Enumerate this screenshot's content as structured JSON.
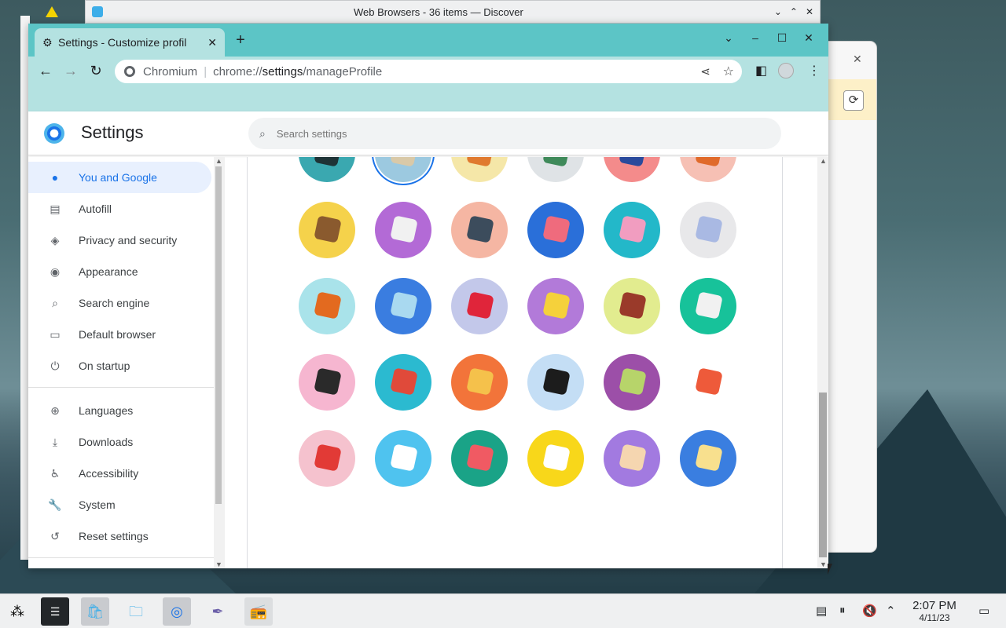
{
  "desktop": {
    "discover_title": "Web Browsers - 36 items — Discover",
    "discover_controls": [
      "⌄",
      "⌃",
      "✕"
    ]
  },
  "browser": {
    "tab_title": "Settings - Customize profil",
    "tab_close": "✕",
    "new_tab": "+",
    "window_controls": [
      "⌄",
      "–",
      "☐",
      "✕"
    ],
    "omnibox": {
      "host": "Chromium",
      "url_prefix": "chrome://",
      "url_bold": "settings",
      "url_suffix": "/manageProfile"
    }
  },
  "settings": {
    "title": "Settings",
    "search_placeholder": "Search settings",
    "nav_items": [
      {
        "label": "You and Google",
        "icon": "person-icon",
        "selected": true
      },
      {
        "label": "Autofill",
        "icon": "clipboard-icon"
      },
      {
        "label": "Privacy and security",
        "icon": "shield-icon"
      },
      {
        "label": "Appearance",
        "icon": "palette-icon"
      },
      {
        "label": "Search engine",
        "icon": "search-icon"
      },
      {
        "label": "Default browser",
        "icon": "browser-icon"
      },
      {
        "label": "On startup",
        "icon": "power-icon"
      },
      {
        "label": "Languages",
        "icon": "globe-icon"
      },
      {
        "label": "Downloads",
        "icon": "download-icon"
      },
      {
        "label": "Accessibility",
        "icon": "accessibility-icon"
      },
      {
        "label": "System",
        "icon": "wrench-icon"
      },
      {
        "label": "Reset settings",
        "icon": "history-icon"
      }
    ],
    "avatar_rows": [
      [
        {
          "name": "avatar-generic-person",
          "bg": "#3aa8b0",
          "fg": "#1e3336"
        },
        {
          "name": "avatar-origami-cat",
          "bg": "#9cc9e0",
          "fg": "#d9c9a8",
          "selected": true
        },
        {
          "name": "avatar-origami-fox",
          "bg": "#f5e7a8",
          "fg": "#e07a2f"
        },
        {
          "name": "avatar-origami-dragon",
          "bg": "#dfe3e6",
          "fg": "#3f8a5a"
        },
        {
          "name": "avatar-origami-elephant",
          "bg": "#f48b8b",
          "fg": "#2a4a9c"
        },
        {
          "name": "avatar-origami-fox-2",
          "bg": "#f6c0b4",
          "fg": "#e06a2a"
        }
      ],
      [
        {
          "name": "avatar-origami-monkey",
          "bg": "#f5d24b",
          "fg": "#8a5a2e"
        },
        {
          "name": "avatar-origami-panda",
          "bg": "#b36ad6",
          "fg": "#f1f1f1"
        },
        {
          "name": "avatar-origami-penguin",
          "bg": "#f5b6a3",
          "fg": "#3c4c5c"
        },
        {
          "name": "avatar-origami-butterfly",
          "bg": "#2a6fd9",
          "fg": "#ef6b7d"
        },
        {
          "name": "avatar-origami-rabbit",
          "bg": "#23b8c9",
          "fg": "#f19dc0"
        },
        {
          "name": "avatar-origami-unicorn",
          "bg": "#e8e8ea",
          "fg": "#a9b9e3"
        }
      ],
      [
        {
          "name": "avatar-basketball",
          "bg": "#a9e3ea",
          "fg": "#e36a1f"
        },
        {
          "name": "avatar-bike",
          "bg": "#3a7de0",
          "fg": "#a9d9f0"
        },
        {
          "name": "avatar-red-bird",
          "bg": "#c3c8ea",
          "fg": "#e0253a"
        },
        {
          "name": "avatar-cheese",
          "bg": "#b27ad9",
          "fg": "#f5d13b"
        },
        {
          "name": "avatar-football",
          "bg": "#e2ec8f",
          "fg": "#9a3a2a"
        },
        {
          "name": "avatar-burger",
          "bg": "#17c29a",
          "fg": "#f1f1f1"
        }
      ],
      [
        {
          "name": "avatar-cool-glasses",
          "bg": "#f6b6d0",
          "fg": "#2a2a2a"
        },
        {
          "name": "avatar-sushi",
          "bg": "#2bbad0",
          "fg": "#e04a3a"
        },
        {
          "name": "avatar-tamagotchi",
          "bg": "#f2743a",
          "fg": "#f5c14b"
        },
        {
          "name": "avatar-vinyl",
          "bg": "#c4def5",
          "fg": "#1c1c1c"
        },
        {
          "name": "avatar-avocado",
          "bg": "#9c4fa8",
          "fg": "#b7d46a"
        },
        {
          "name": "avatar-smile",
          "bg": "#ffffff",
          "fg": "#ee5a3a"
        }
      ],
      [
        {
          "name": "avatar-ice-cream",
          "bg": "#f5c2ce",
          "fg": "#e23a36"
        },
        {
          "name": "avatar-ice-cubes",
          "bg": "#4fc3ef",
          "fg": "#ffffff"
        },
        {
          "name": "avatar-watermelon",
          "bg": "#1aa387",
          "fg": "#f05a63"
        },
        {
          "name": "avatar-onigiri",
          "bg": "#f8d71a",
          "fg": "#ffffff"
        },
        {
          "name": "avatar-pizza",
          "bg": "#a27ae0",
          "fg": "#f5d6b0"
        },
        {
          "name": "avatar-sandwich",
          "bg": "#3a7ee0",
          "fg": "#f8e08e"
        }
      ]
    ]
  },
  "taskbar": {
    "apps": [
      "app-launcher",
      "settings-app",
      "discover-app",
      "files-app",
      "chromium-app",
      "krita-app",
      "radio-app"
    ],
    "clock_time": "2:07 PM",
    "clock_date": "4/11/23"
  },
  "colors": {
    "accent": "#1a73e8",
    "tab_strip": "#5cc5c6",
    "toolbar": "#b4e2e1"
  }
}
